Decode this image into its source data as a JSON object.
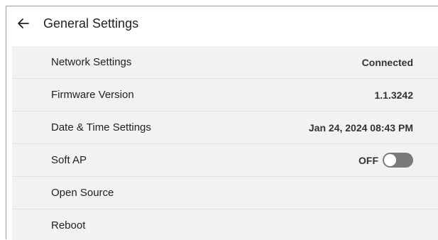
{
  "header": {
    "title": "General Settings",
    "back_icon": "arrow-left-icon"
  },
  "settings": {
    "network": {
      "label": "Network Settings",
      "value": "Connected"
    },
    "firmware": {
      "label": "Firmware Version",
      "value": "1.1.3242"
    },
    "datetime": {
      "label": "Date & Time Settings",
      "value": "Jan 24, 2024 08:43 PM"
    },
    "softap": {
      "label": "Soft AP",
      "value": "OFF",
      "enabled": false
    },
    "opensource": {
      "label": "Open Source"
    },
    "reboot": {
      "label": "Reboot"
    }
  },
  "colors": {
    "background": "#ffffff",
    "list_background": "#f2f2f2",
    "toggle_off": "#7a7a7a"
  }
}
